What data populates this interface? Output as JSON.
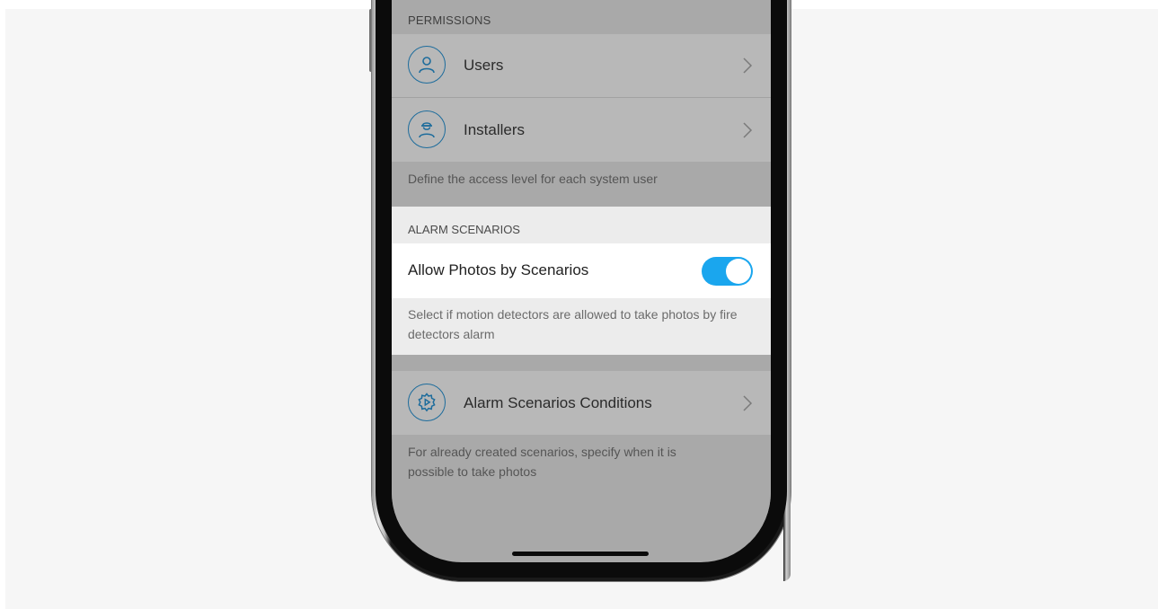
{
  "permissions": {
    "header": "PERMISSIONS",
    "items": [
      {
        "label": "Users",
        "icon": "user-icon"
      },
      {
        "label": "Installers",
        "icon": "installer-icon"
      }
    ],
    "footnote": "Define the access level for each system user"
  },
  "alarm_scenarios": {
    "header": "ALARM SCENARIOS",
    "toggle_label": "Allow Photos by Scenarios",
    "toggle_on": true,
    "note": "Select if motion detectors are allowed to take photos by fire detectors alarm"
  },
  "conditions": {
    "label": "Alarm Scenarios Conditions",
    "icon": "scenario-gear-icon",
    "footnote": "For already created scenarios, specify when it is possible to take photos"
  },
  "colors": {
    "accent": "#1aa6ee",
    "icon_stroke": "#1d6c9c",
    "overlay_gray": "#a9a9a9"
  }
}
